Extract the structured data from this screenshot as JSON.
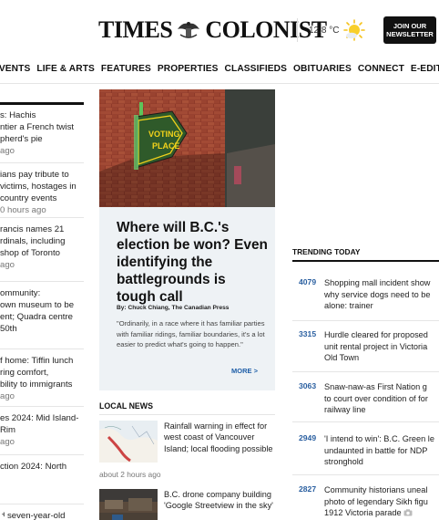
{
  "header": {
    "logo_text_left": "TIMES",
    "logo_text_right": "COLONIST",
    "temperature": "12.8 °C",
    "weather_icon": "sun-cloud-icon",
    "newsletter_line1": "JOIN OUR",
    "newsletter_line2": "NEWSLETTER"
  },
  "nav": {
    "items": [
      "EVENTS",
      "LIFE & ARTS",
      "FEATURES",
      "PROPERTIES",
      "CLASSIFIEDS",
      "OBITUARIES",
      "CONNECT",
      "E-EDITION"
    ]
  },
  "left_column": {
    "items": [
      {
        "lines": [
          "s: Hachis",
          "ntier a French twist",
          "pherd's pie"
        ],
        "time": "ago"
      },
      {
        "lines": [
          "ians pay tribute to",
          "victims, hostages in",
          "country events"
        ],
        "time": "0 hours ago"
      },
      {
        "lines": [
          "rancis names 21",
          "rdinals, including",
          "shop of Toronto"
        ],
        "time": "ago"
      },
      {
        "lines": [
          "ommunity:",
          "own museum to be",
          "ent; Quadra centre",
          "50th"
        ],
        "time": ""
      },
      {
        "lines": [
          "f home: Tiffin lunch",
          "ring comfort,",
          "bility to immigrants"
        ],
        "time": "ago"
      },
      {
        "lines": [
          "es 2024: Mid Island-",
          "Rim"
        ],
        "time": "ago"
      },
      {
        "lines": [
          "ction 2024: North"
        ],
        "time": ""
      },
      {
        "lines": [
          "d seven-year-old"
        ],
        "time": ""
      }
    ]
  },
  "feature": {
    "sign_line1": "VOTING",
    "sign_line2": "PLACE",
    "title": "Where will B.C.'s election be won? Even identifying the battlegrounds is tough call",
    "byline": "By: Chuck Chiang, The Canadian Press",
    "summary": "\"Ordinarily, in a race where it has familiar parties with familiar ridings, familiar boundaries, it's a lot easier to predict what's going to happen.\"",
    "more_label": "MORE >"
  },
  "local_news": {
    "heading": "LOCAL NEWS",
    "items": [
      {
        "title": "Rainfall warning in effect for west coast of Vancouver Island; local flooding possible",
        "time": "about 2 hours ago",
        "thumb_icon": "map-thumbnail"
      },
      {
        "title": "B.C. drone company building 'Google Streetview in the sky'",
        "time": "",
        "thumb_icon": "aerial-photo-thumbnail"
      }
    ]
  },
  "trending": {
    "heading": "TRENDING TODAY",
    "items": [
      {
        "count": "4079",
        "lines": [
          "Shopping mall incident show",
          "why service dogs need to be",
          "alone: trainer"
        ]
      },
      {
        "count": "3315",
        "lines": [
          "Hurdle cleared for proposed",
          "unit rental project in Victoria",
          "Old Town"
        ]
      },
      {
        "count": "3063",
        "lines": [
          "Snaw-naw-as First Nation g",
          "to court over condition of for",
          "railway line"
        ]
      },
      {
        "count": "2949",
        "lines": [
          "'I intend to win': B.C. Green le",
          "undaunted in battle for NDP",
          "stronghold"
        ]
      },
      {
        "count": "2827",
        "lines": [
          "Community historians uneal",
          "photo of legendary Sikh figu",
          "1912 Victoria parade"
        ]
      }
    ]
  },
  "colors": {
    "accent_blue": "#2a5fa0",
    "more_blue": "#1f5fa8",
    "feature_bg": "#eef2f5",
    "sign_green": "#2f5a2a",
    "sign_yellow": "#f2d21b"
  }
}
